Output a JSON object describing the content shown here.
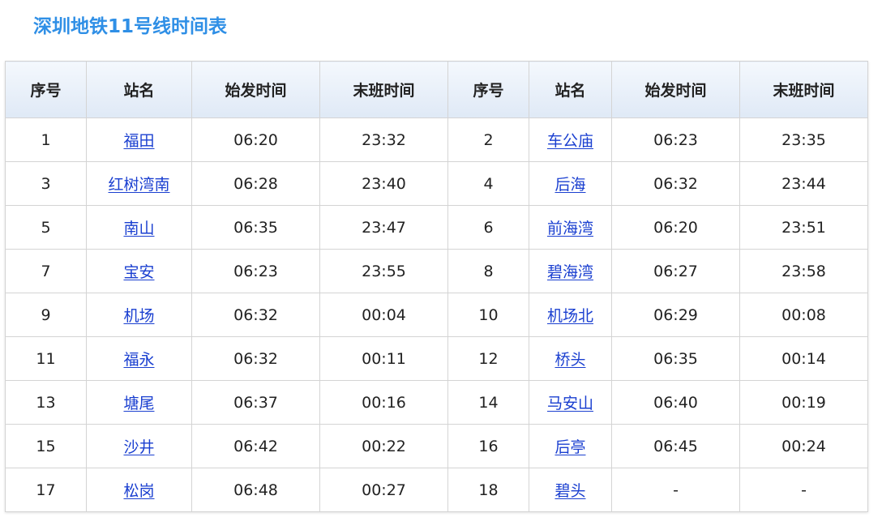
{
  "page": {
    "title": "深圳地铁11号线时间表"
  },
  "colors": {
    "title": "#2f8fe6",
    "link": "#1a3fd0",
    "header_bg": "#e6eef8",
    "border": "#d4d4d4"
  },
  "table": {
    "headers": [
      "序号",
      "站名",
      "始发时间",
      "末班时间",
      "序号",
      "站名",
      "始发时间",
      "末班时间"
    ],
    "rows": [
      [
        {
          "no": "1",
          "name": "福田",
          "first": "06:20",
          "last": "23:32"
        },
        {
          "no": "2",
          "name": "车公庙",
          "first": "06:23",
          "last": "23:35"
        }
      ],
      [
        {
          "no": "3",
          "name": "红树湾南",
          "first": "06:28",
          "last": "23:40"
        },
        {
          "no": "4",
          "name": "后海",
          "first": "06:32",
          "last": "23:44"
        }
      ],
      [
        {
          "no": "5",
          "name": "南山",
          "first": "06:35",
          "last": "23:47"
        },
        {
          "no": "6",
          "name": "前海湾",
          "first": "06:20",
          "last": "23:51"
        }
      ],
      [
        {
          "no": "7",
          "name": "宝安",
          "first": "06:23",
          "last": "23:55"
        },
        {
          "no": "8",
          "name": "碧海湾",
          "first": "06:27",
          "last": "23:58"
        }
      ],
      [
        {
          "no": "9",
          "name": "机场",
          "first": "06:32",
          "last": "00:04"
        },
        {
          "no": "10",
          "name": "机场北",
          "first": "06:29",
          "last": "00:08"
        }
      ],
      [
        {
          "no": "11",
          "name": "福永",
          "first": "06:32",
          "last": "00:11"
        },
        {
          "no": "12",
          "name": "桥头",
          "first": "06:35",
          "last": "00:14"
        }
      ],
      [
        {
          "no": "13",
          "name": "塘尾",
          "first": "06:37",
          "last": "00:16"
        },
        {
          "no": "14",
          "name": "马安山",
          "first": "06:40",
          "last": "00:19"
        }
      ],
      [
        {
          "no": "15",
          "name": "沙井",
          "first": "06:42",
          "last": "00:22"
        },
        {
          "no": "16",
          "name": "后亭",
          "first": "06:45",
          "last": "00:24"
        }
      ],
      [
        {
          "no": "17",
          "name": "松岗",
          "first": "06:48",
          "last": "00:27"
        },
        {
          "no": "18",
          "name": "碧头",
          "first": "-",
          "last": "-"
        }
      ]
    ]
  }
}
